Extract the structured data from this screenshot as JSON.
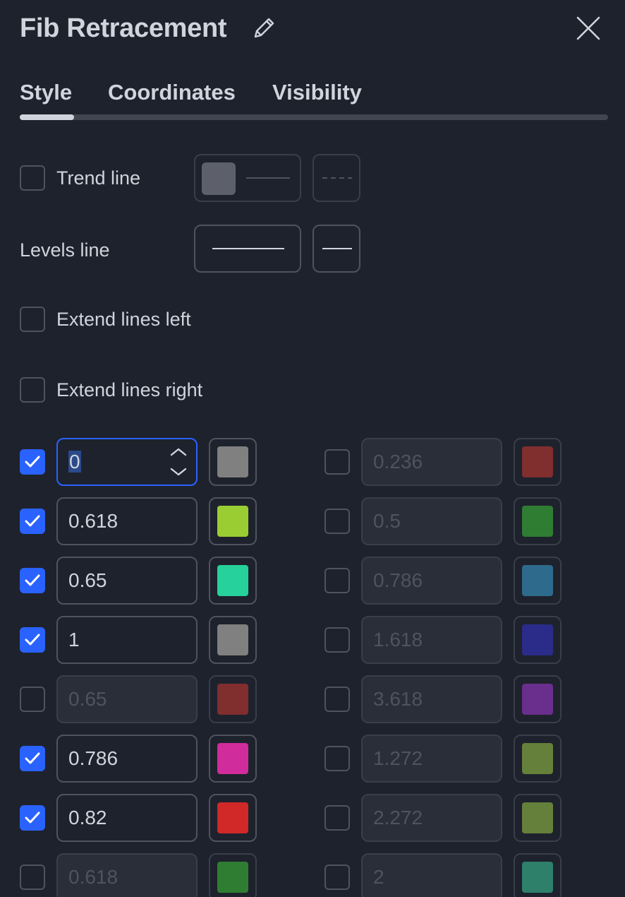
{
  "header": {
    "title": "Fib Retracement"
  },
  "tabs": [
    {
      "label": "Style"
    },
    {
      "label": "Coordinates"
    },
    {
      "label": "Visibility"
    }
  ],
  "options": {
    "trend_line_label": "Trend line",
    "trend_line_checked": false,
    "trend_line_color": "#5d606b",
    "levels_line_label": "Levels line",
    "extend_left_label": "Extend lines left",
    "extend_left_checked": false,
    "extend_right_label": "Extend lines right",
    "extend_right_checked": false
  },
  "levels_left": [
    {
      "value": "0",
      "checked": true,
      "color": "#808080"
    },
    {
      "value": "0.618",
      "checked": true,
      "color": "#9acd32"
    },
    {
      "value": "0.65",
      "checked": true,
      "color": "#26d19c"
    },
    {
      "value": "1",
      "checked": true,
      "color": "#808080"
    },
    {
      "value": "0.65",
      "checked": false,
      "color": "#802e2e"
    },
    {
      "value": "0.786",
      "checked": true,
      "color": "#d02c9c"
    },
    {
      "value": "0.82",
      "checked": true,
      "color": "#d12828"
    },
    {
      "value": "0.618",
      "checked": false,
      "color": "#2f7d32"
    }
  ],
  "levels_right": [
    {
      "value": "0.236",
      "checked": false,
      "color": "#802e2e"
    },
    {
      "value": "0.5",
      "checked": false,
      "color": "#2f7d32"
    },
    {
      "value": "0.786",
      "checked": false,
      "color": "#2e6a8c"
    },
    {
      "value": "1.618",
      "checked": false,
      "color": "#2b2b8a"
    },
    {
      "value": "3.618",
      "checked": false,
      "color": "#6a2e8c"
    },
    {
      "value": "1.272",
      "checked": false,
      "color": "#64803a"
    },
    {
      "value": "2.272",
      "checked": false,
      "color": "#64803a"
    },
    {
      "value": "2",
      "checked": false,
      "color": "#2e806a"
    }
  ],
  "colors": {
    "background": "#1e222d",
    "accent": "#2962ff",
    "text": "#d1d4dc",
    "border": "#50535e"
  }
}
